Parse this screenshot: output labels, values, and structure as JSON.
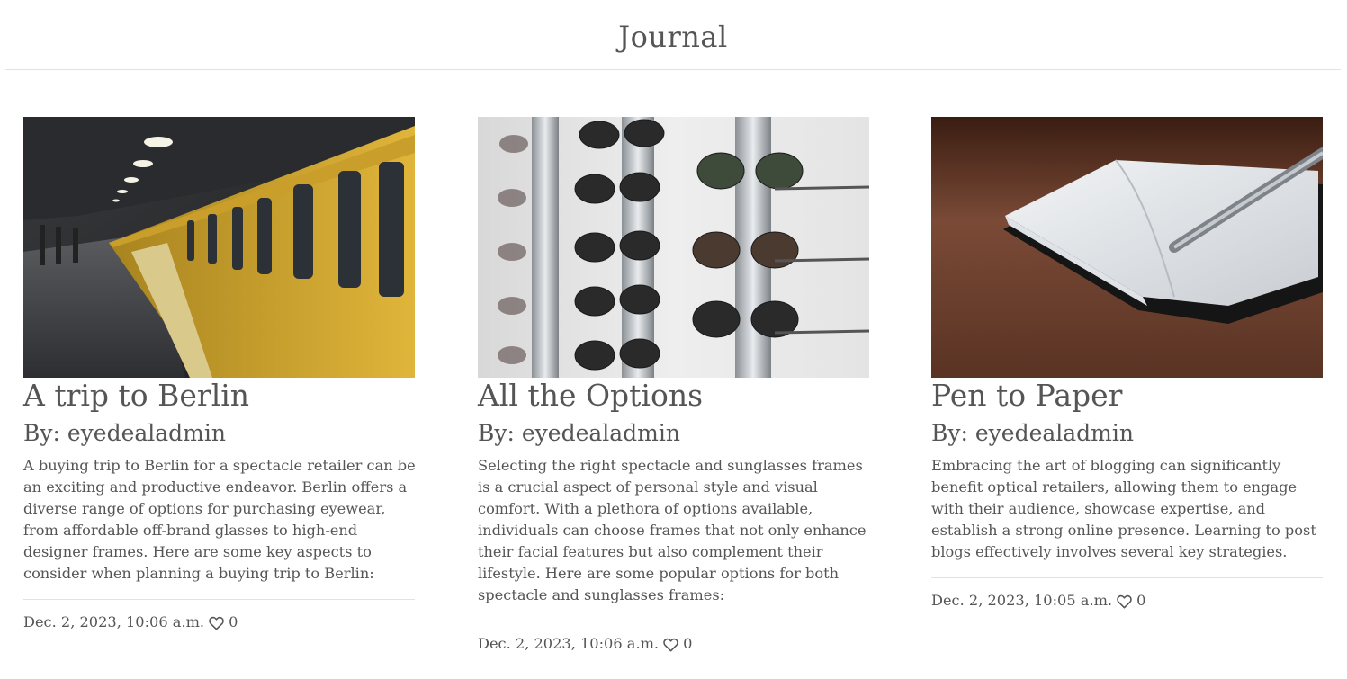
{
  "header": {
    "title": "Journal"
  },
  "posts": [
    {
      "title": "A trip to Berlin",
      "author": "By: eyedealadmin",
      "excerpt": "A buying trip to Berlin for a spectacle retailer can be an exciting and productive endeavor. Berlin offers a diverse range of options for purchasing eyewear, from affordable off-brand glasses to high-end designer frames. Here are some key aspects to consider when planning a buying trip to Berlin:",
      "date": "Dec. 2, 2023, 10:06 a.m.",
      "likes": "0",
      "image": "subway-train-image"
    },
    {
      "title": "All the Options",
      "author": "By: eyedealadmin",
      "excerpt": "Selecting the right spectacle and sunglasses frames is a crucial aspect of personal style and visual comfort. With a plethora of options available, individuals can choose frames that not only enhance their facial features but also complement their lifestyle. Here are some popular options for both spectacle and sunglasses frames:",
      "date": "Dec. 2, 2023, 10:06 a.m.",
      "likes": "0",
      "image": "sunglasses-rack-image"
    },
    {
      "title": "Pen to Paper",
      "author": "By: eyedealadmin",
      "excerpt": "Embracing the art of blogging can significantly benefit optical retailers, allowing them to engage with their audience, showcase expertise, and establish a strong online presence. Learning to post blogs effectively involves several key strategies.",
      "date": "Dec. 2, 2023, 10:05 a.m.",
      "likes": "0",
      "image": "notebook-pen-image"
    }
  ],
  "icons": {
    "like": "heart-icon"
  },
  "colors": {
    "text": "#555555",
    "divider": "#e2e2e2"
  }
}
